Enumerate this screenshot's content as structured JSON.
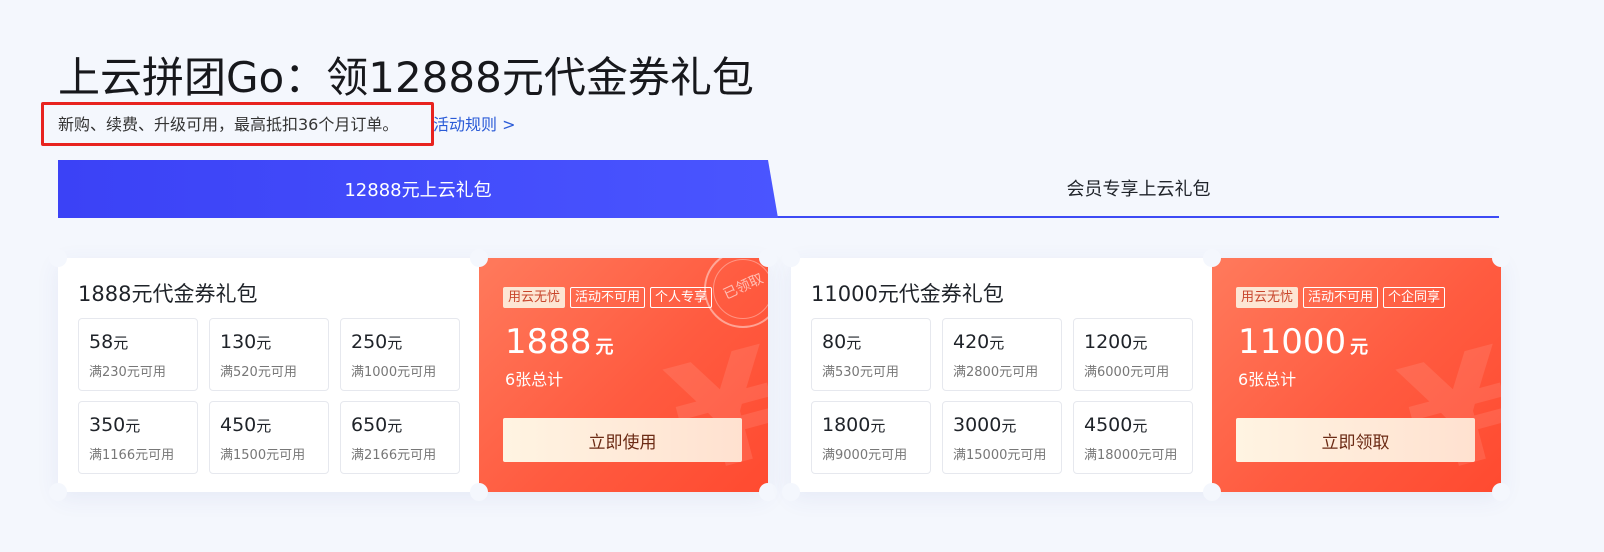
{
  "header": {
    "title": "上云拼团Go：领12888元代金券礼包",
    "subtitle": "新购、续费、升级可用，最高抵扣36个月订单。",
    "rules_link": "活动规则 >"
  },
  "tabs": [
    {
      "label": "12888元上云礼包",
      "active": true
    },
    {
      "label": "会员专享上云礼包",
      "active": false
    }
  ],
  "colors": {
    "accent": "#3d4bf5",
    "card_orange": "#ff5b40",
    "highlight_box": "#e8231f"
  },
  "cards": [
    {
      "title": "1888元代金券礼包",
      "coupons": [
        {
          "amount": "58",
          "unit": "元",
          "condition": "满230元可用"
        },
        {
          "amount": "130",
          "unit": "元",
          "condition": "满520元可用"
        },
        {
          "amount": "250",
          "unit": "元",
          "condition": "满1000元可用"
        },
        {
          "amount": "350",
          "unit": "元",
          "condition": "满1166元可用"
        },
        {
          "amount": "450",
          "unit": "元",
          "condition": "满1500元可用"
        },
        {
          "amount": "650",
          "unit": "元",
          "condition": "满2166元可用"
        }
      ],
      "tags": [
        "用云无忧",
        "活动不可用",
        "个人专享"
      ],
      "stamp": "已领取",
      "total": "1888",
      "total_unit": "元",
      "count": "6张总计",
      "button": "立即使用"
    },
    {
      "title": "11000元代金券礼包",
      "coupons": [
        {
          "amount": "80",
          "unit": "元",
          "condition": "满530元可用"
        },
        {
          "amount": "420",
          "unit": "元",
          "condition": "满2800元可用"
        },
        {
          "amount": "1200",
          "unit": "元",
          "condition": "满6000元可用"
        },
        {
          "amount": "1800",
          "unit": "元",
          "condition": "满9000元可用"
        },
        {
          "amount": "3000",
          "unit": "元",
          "condition": "满15000元可用"
        },
        {
          "amount": "4500",
          "unit": "元",
          "condition": "满18000元可用"
        }
      ],
      "tags": [
        "用云无忧",
        "活动不可用",
        "个企同享"
      ],
      "total": "11000",
      "total_unit": "元",
      "count": "6张总计",
      "button": "立即领取"
    }
  ]
}
